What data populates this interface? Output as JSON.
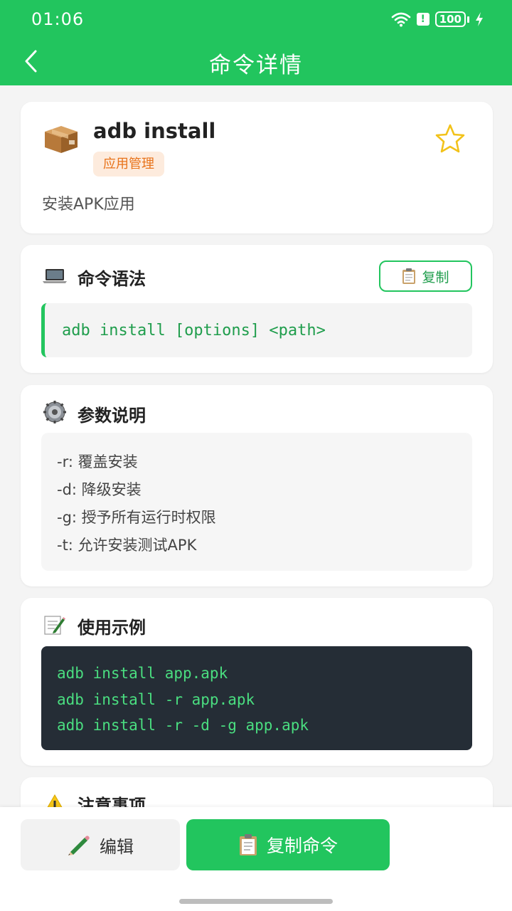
{
  "status_bar": {
    "time": "01:06",
    "battery": "100"
  },
  "header": {
    "title": "命令详情"
  },
  "command": {
    "name": "adb install",
    "category": "应用管理",
    "description": "安装APK应用"
  },
  "syntax": {
    "title": "命令语法",
    "copy_label": "复制",
    "text": "adb install [options] <path>"
  },
  "params": {
    "title": "参数说明",
    "lines": [
      "-r: 覆盖安装",
      "-d: 降级安装",
      "-g: 授予所有运行时权限",
      "-t: 允许安装测试APK"
    ]
  },
  "examples": {
    "title": "使用示例",
    "lines": [
      "adb install app.apk",
      "adb install -r app.apk",
      "adb install -r -d -g app.apk"
    ]
  },
  "notes": {
    "title": "注意事项"
  },
  "bottom": {
    "edit_label": "编辑",
    "copy_label": "复制命令"
  },
  "colors": {
    "primary": "#22c55e",
    "badge_bg": "#fdebdd",
    "badge_text": "#e8731a",
    "code_bg": "#252d36",
    "code_text": "#4ade80"
  }
}
